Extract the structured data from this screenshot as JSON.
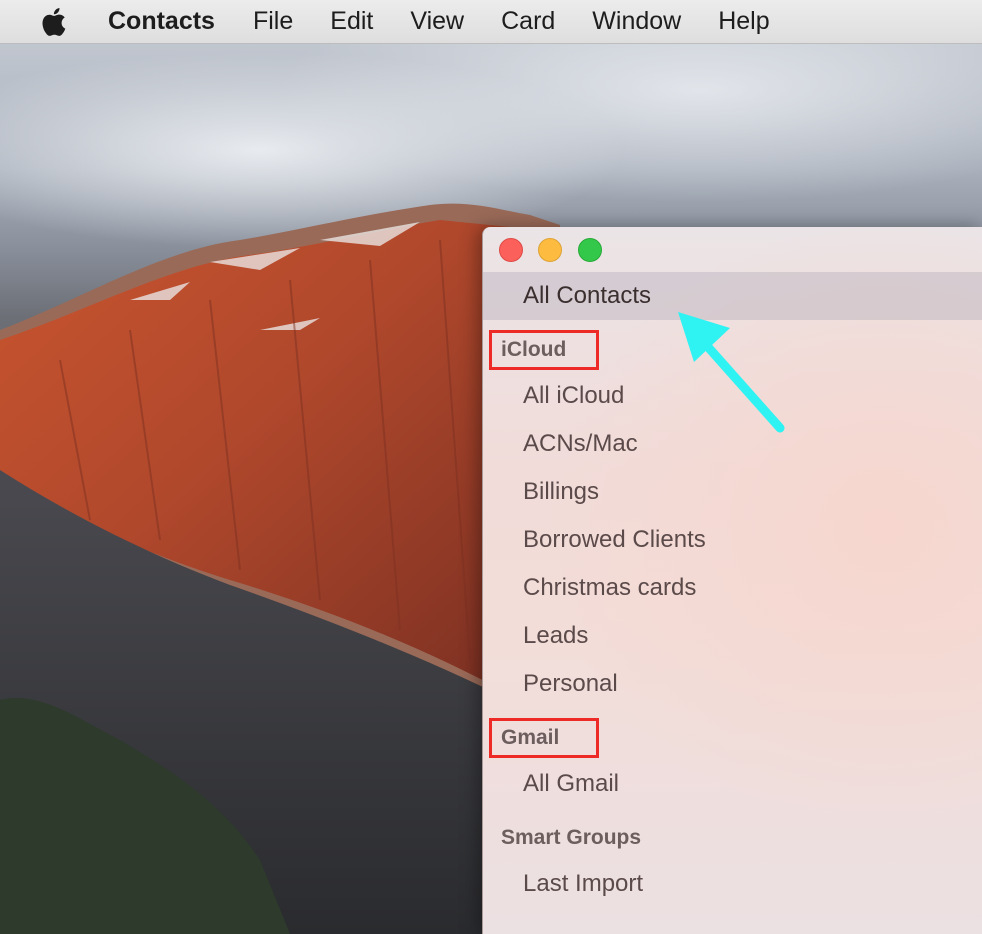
{
  "menubar": {
    "apple_icon": "apple-logo-icon",
    "app_name": "Contacts",
    "items": [
      "File",
      "Edit",
      "View",
      "Card",
      "Window",
      "Help"
    ]
  },
  "window": {
    "traffic_lights": {
      "close": "#fc605b",
      "minimize": "#fdbc40",
      "zoom": "#34c84a"
    },
    "all_contacts": "All Contacts",
    "icloud": {
      "header": "iCloud",
      "items": [
        "All iCloud",
        "ACNs/Mac",
        "Billings",
        "Borrowed Clients",
        "Christmas cards",
        "Leads",
        "Personal"
      ]
    },
    "gmail": {
      "header": "Gmail",
      "items": [
        "All Gmail"
      ]
    },
    "smart_groups": {
      "header": "Smart Groups",
      "items": [
        "Last Import"
      ]
    }
  },
  "annotations": {
    "highlight_color": "#ee2a26",
    "arrow_color": "#2ff2f2"
  }
}
